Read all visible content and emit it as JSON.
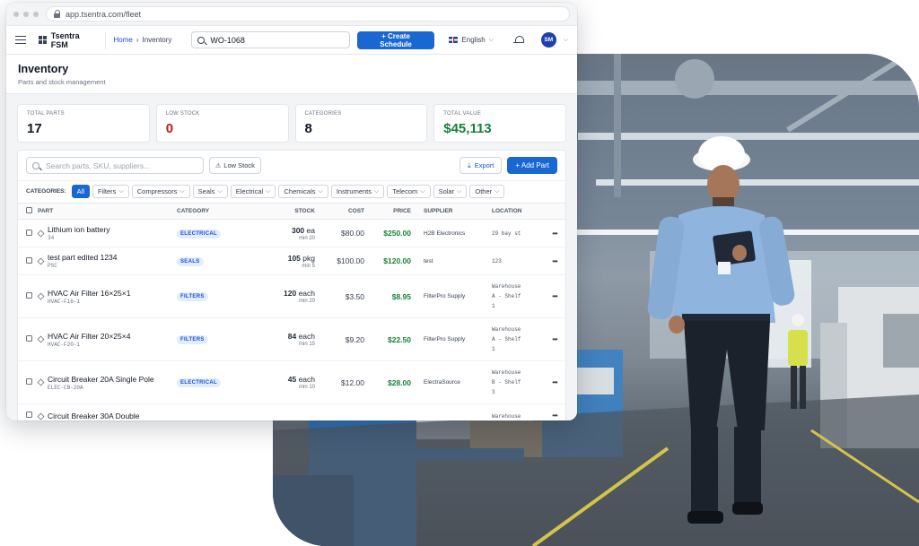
{
  "browser": {
    "url": "app.tsentra.com/fleet"
  },
  "appbar": {
    "brand": "Tsentra FSM",
    "breadcrumb": {
      "home": "Home",
      "sep": "›",
      "current": "Inventory"
    },
    "search_value": "WO-1068",
    "create_label": "+ Create Schedule",
    "language": "English",
    "avatar_initials": "SM"
  },
  "page": {
    "title": "Inventory",
    "subtitle": "Parts and stock management"
  },
  "stats": [
    {
      "label": "TOTAL PARTS",
      "value": "17",
      "color": "#111827"
    },
    {
      "label": "LOW STOCK",
      "value": "0",
      "color": "#b91c1c"
    },
    {
      "label": "CATEGORIES",
      "value": "8",
      "color": "#111827"
    },
    {
      "label": "TOTAL VALUE",
      "value": "$45,113",
      "color": "#15803d"
    }
  ],
  "toolbar": {
    "search_placeholder": "Search parts, SKU, suppliers...",
    "low_stock_label": "Low Stock",
    "export_label": "Export",
    "add_part_label": "+ Add Part"
  },
  "categories": {
    "label": "CATEGORIES:",
    "all": "All",
    "chips": [
      "Filters",
      "Compressors",
      "Seals",
      "Electrical",
      "Chemicals",
      "Instruments",
      "Telecom",
      "Solar",
      "Other"
    ]
  },
  "table": {
    "headers": {
      "part": "PART",
      "category": "CATEGORY",
      "stock": "STOCK",
      "cost": "COST",
      "price": "PRICE",
      "supplier": "SUPPLIER",
      "location": "LOCATION"
    },
    "rows": [
      {
        "name": "Lithium ion battery",
        "sku": "34",
        "category": "ELECTRICAL",
        "qty": "300",
        "unit": "ea",
        "min": "min 20",
        "cost": "$80.00",
        "price": "$250.00",
        "supplier": "H2B Electronics",
        "location": [
          "29 bay st"
        ]
      },
      {
        "name": "test part edited 1234",
        "sku": "PSC",
        "category": "SEALS",
        "qty": "105",
        "unit": "pkg",
        "min": "min 5",
        "cost": "$100.00",
        "price": "$120.00",
        "supplier": "test",
        "location": [
          "123"
        ]
      },
      {
        "name": "HVAC Air Filter 16×25×1",
        "sku": "HVAC-F16-1",
        "category": "FILTERS",
        "qty": "120",
        "unit": "each",
        "min": "min 20",
        "cost": "$3.50",
        "price": "$8.95",
        "supplier": "FilterPro Supply",
        "location": [
          "Warehouse",
          "A - Shelf",
          "1"
        ]
      },
      {
        "name": "HVAC Air Filter 20×25×4",
        "sku": "HVAC-F20-1",
        "category": "FILTERS",
        "qty": "84",
        "unit": "each",
        "min": "min 15",
        "cost": "$9.20",
        "price": "$22.50",
        "supplier": "FilterPro Supply",
        "location": [
          "Warehouse",
          "A - Shelf",
          "1"
        ]
      },
      {
        "name": "Circuit Breaker 20A Single Pole",
        "sku": "ELEC-CB-20A",
        "category": "ELECTRICAL",
        "qty": "45",
        "unit": "each",
        "min": "min 10",
        "cost": "$12.00",
        "price": "$28.00",
        "supplier": "ElectraSource",
        "location": [
          "Warehouse",
          "B - Shelf",
          "3"
        ]
      },
      {
        "name": "Circuit Breaker 30A Double",
        "sku": "",
        "category": "",
        "qty": "",
        "unit": "",
        "min": "",
        "cost": "",
        "price": "",
        "supplier": "",
        "location": [
          "Warehouse"
        ]
      }
    ]
  }
}
